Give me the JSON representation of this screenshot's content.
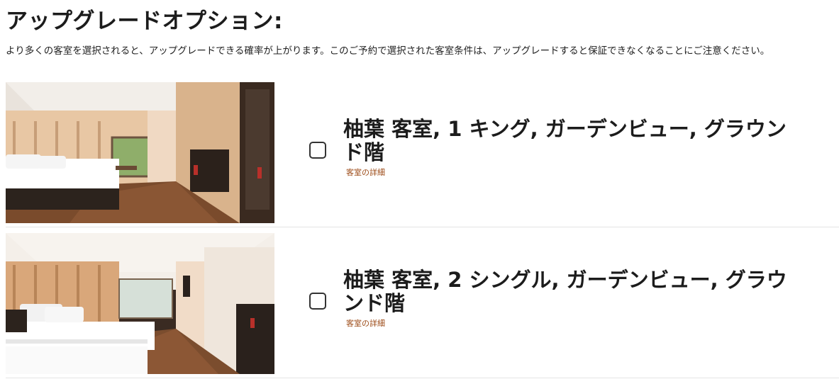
{
  "upgrade": {
    "heading": "アップグレードオプション:",
    "note": "より多くの客室を選択されると、アップグレードできる確率が上がります。このご予約で選択された客室条件は、アップグレードすると保証できなくなることにご注意ください。",
    "options": [
      {
        "title": "柚葉 客室, 1 キング, ガーデンビュー, グラウンド階",
        "details_link": "客室の詳細",
        "checked": false
      },
      {
        "title": "柚葉 客室, 2 シングル, ガーデンビュー, グラウンド階",
        "details_link": "客室の詳細",
        "checked": false
      }
    ]
  },
  "colors": {
    "text": "#1c1c1c",
    "link": "#9c4a16",
    "divider": "#e4e4e4"
  }
}
